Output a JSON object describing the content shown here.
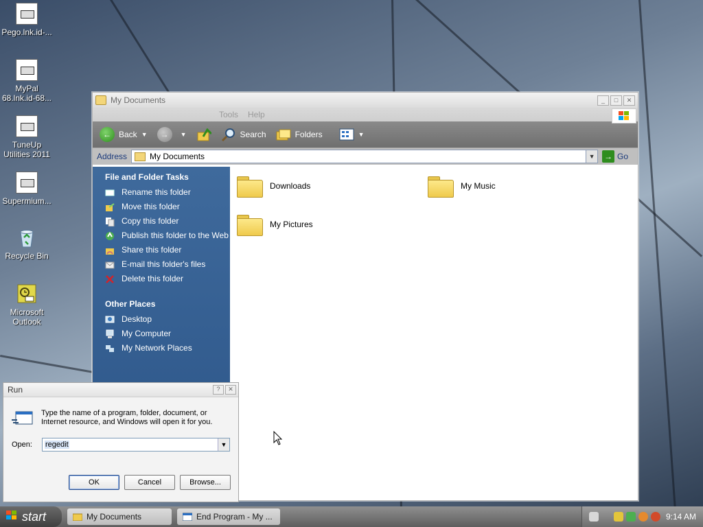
{
  "desktop": {
    "icons": [
      {
        "label": "Pego.lnk.id-..."
      },
      {
        "label": "MyPal 68.lnk.id-68..."
      },
      {
        "label": "TuneUp Utilities 2011"
      },
      {
        "label": "Supermium..."
      },
      {
        "label": "Recycle Bin"
      },
      {
        "label": "Microsoft Outlook"
      }
    ]
  },
  "explorer": {
    "title": "My Documents",
    "menu": [
      "Tools",
      "Help"
    ],
    "toolbar": {
      "back": "Back",
      "search": "Search",
      "folders": "Folders"
    },
    "address": {
      "label": "Address",
      "value": "My Documents",
      "go": "Go"
    },
    "file_tasks": {
      "heading": "File and Folder Tasks",
      "items": [
        "Rename this folder",
        "Move this folder",
        "Copy this folder",
        "Publish this folder to the Web",
        "Share this folder",
        "E-mail this folder's files",
        "Delete this folder"
      ]
    },
    "other_places": {
      "heading": "Other Places",
      "items": [
        "Desktop",
        "My Computer",
        "My Network Places"
      ]
    },
    "folders": [
      "Downloads",
      "My Music",
      "My Pictures"
    ]
  },
  "run_dialog": {
    "title": "Run",
    "description": "Type the name of a program, folder, document, or Internet resource, and Windows will open it for you.",
    "open_label": "Open:",
    "open_value": "regedit",
    "ok": "OK",
    "cancel": "Cancel",
    "browse": "Browse..."
  },
  "taskbar": {
    "start": "start",
    "tasks": [
      "My Documents",
      "End Program - My ..."
    ],
    "clock": "9:14 AM"
  },
  "colors": {
    "taskpane": "#3f6a9c",
    "accent_green": "#2e8d1e"
  }
}
